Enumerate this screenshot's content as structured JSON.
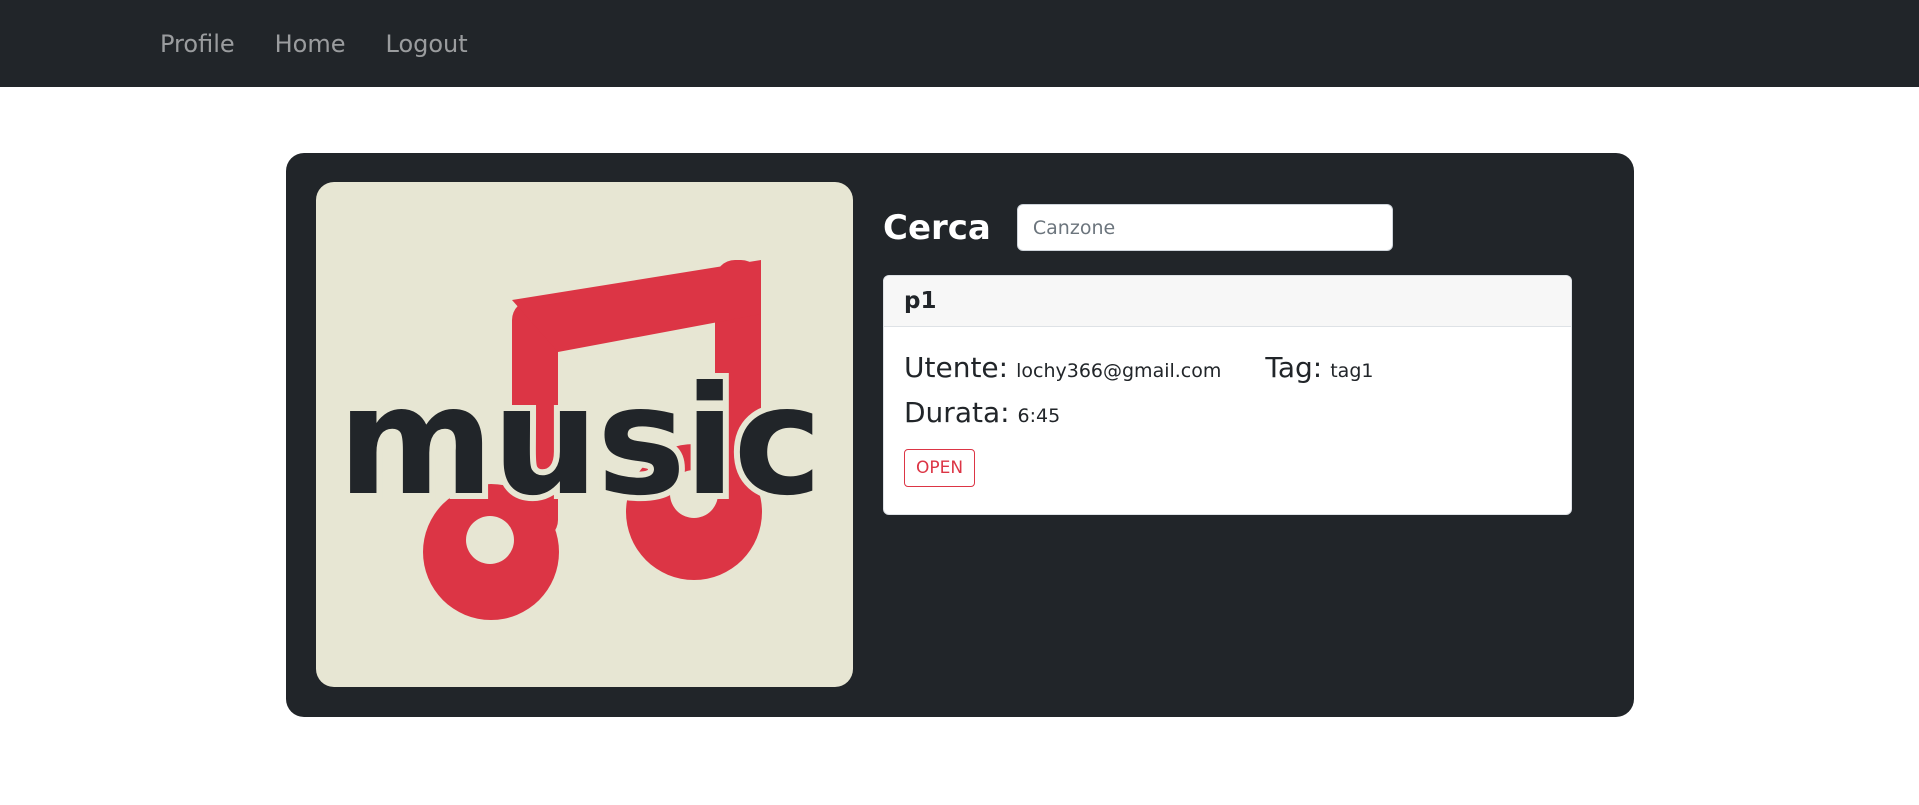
{
  "navbar": {
    "items": [
      {
        "label": "Profile"
      },
      {
        "label": "Home"
      },
      {
        "label": "Logout"
      }
    ]
  },
  "artwork": {
    "logo_text": "music",
    "background_color": "#e7e6d3",
    "note_color": "#dc3545",
    "text_color": "#212529"
  },
  "search": {
    "title": "Cerca",
    "placeholder": "Canzone",
    "value": ""
  },
  "result": {
    "title": "p1",
    "utente_label": "Utente:",
    "utente_value": "lochy366@gmail.com",
    "tag_label": "Tag:",
    "tag_value": "tag1",
    "durata_label": "Durata:",
    "durata_value": "6:45",
    "open_label": "OPEN"
  },
  "colors": {
    "nav_bg": "#212529",
    "card_bg": "#212529",
    "danger": "#dc3545"
  }
}
